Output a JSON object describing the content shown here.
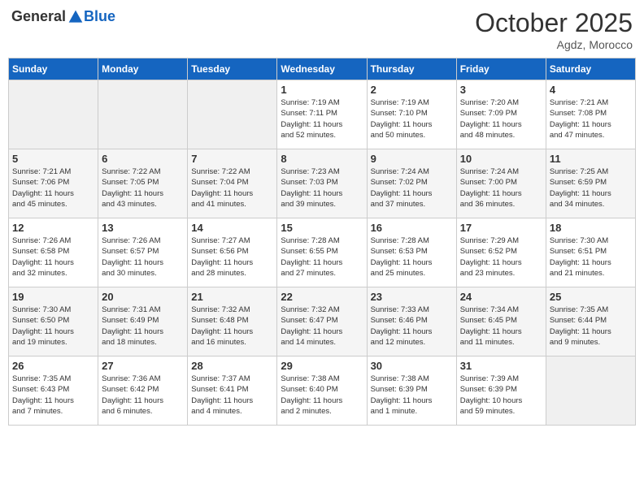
{
  "header": {
    "logo_general": "General",
    "logo_blue": "Blue",
    "month": "October 2025",
    "location": "Agdz, Morocco"
  },
  "weekdays": [
    "Sunday",
    "Monday",
    "Tuesday",
    "Wednesday",
    "Thursday",
    "Friday",
    "Saturday"
  ],
  "weeks": [
    [
      {
        "day": "",
        "info": ""
      },
      {
        "day": "",
        "info": ""
      },
      {
        "day": "",
        "info": ""
      },
      {
        "day": "1",
        "info": "Sunrise: 7:19 AM\nSunset: 7:11 PM\nDaylight: 11 hours\nand 52 minutes."
      },
      {
        "day": "2",
        "info": "Sunrise: 7:19 AM\nSunset: 7:10 PM\nDaylight: 11 hours\nand 50 minutes."
      },
      {
        "day": "3",
        "info": "Sunrise: 7:20 AM\nSunset: 7:09 PM\nDaylight: 11 hours\nand 48 minutes."
      },
      {
        "day": "4",
        "info": "Sunrise: 7:21 AM\nSunset: 7:08 PM\nDaylight: 11 hours\nand 47 minutes."
      }
    ],
    [
      {
        "day": "5",
        "info": "Sunrise: 7:21 AM\nSunset: 7:06 PM\nDaylight: 11 hours\nand 45 minutes."
      },
      {
        "day": "6",
        "info": "Sunrise: 7:22 AM\nSunset: 7:05 PM\nDaylight: 11 hours\nand 43 minutes."
      },
      {
        "day": "7",
        "info": "Sunrise: 7:22 AM\nSunset: 7:04 PM\nDaylight: 11 hours\nand 41 minutes."
      },
      {
        "day": "8",
        "info": "Sunrise: 7:23 AM\nSunset: 7:03 PM\nDaylight: 11 hours\nand 39 minutes."
      },
      {
        "day": "9",
        "info": "Sunrise: 7:24 AM\nSunset: 7:02 PM\nDaylight: 11 hours\nand 37 minutes."
      },
      {
        "day": "10",
        "info": "Sunrise: 7:24 AM\nSunset: 7:00 PM\nDaylight: 11 hours\nand 36 minutes."
      },
      {
        "day": "11",
        "info": "Sunrise: 7:25 AM\nSunset: 6:59 PM\nDaylight: 11 hours\nand 34 minutes."
      }
    ],
    [
      {
        "day": "12",
        "info": "Sunrise: 7:26 AM\nSunset: 6:58 PM\nDaylight: 11 hours\nand 32 minutes."
      },
      {
        "day": "13",
        "info": "Sunrise: 7:26 AM\nSunset: 6:57 PM\nDaylight: 11 hours\nand 30 minutes."
      },
      {
        "day": "14",
        "info": "Sunrise: 7:27 AM\nSunset: 6:56 PM\nDaylight: 11 hours\nand 28 minutes."
      },
      {
        "day": "15",
        "info": "Sunrise: 7:28 AM\nSunset: 6:55 PM\nDaylight: 11 hours\nand 27 minutes."
      },
      {
        "day": "16",
        "info": "Sunrise: 7:28 AM\nSunset: 6:53 PM\nDaylight: 11 hours\nand 25 minutes."
      },
      {
        "day": "17",
        "info": "Sunrise: 7:29 AM\nSunset: 6:52 PM\nDaylight: 11 hours\nand 23 minutes."
      },
      {
        "day": "18",
        "info": "Sunrise: 7:30 AM\nSunset: 6:51 PM\nDaylight: 11 hours\nand 21 minutes."
      }
    ],
    [
      {
        "day": "19",
        "info": "Sunrise: 7:30 AM\nSunset: 6:50 PM\nDaylight: 11 hours\nand 19 minutes."
      },
      {
        "day": "20",
        "info": "Sunrise: 7:31 AM\nSunset: 6:49 PM\nDaylight: 11 hours\nand 18 minutes."
      },
      {
        "day": "21",
        "info": "Sunrise: 7:32 AM\nSunset: 6:48 PM\nDaylight: 11 hours\nand 16 minutes."
      },
      {
        "day": "22",
        "info": "Sunrise: 7:32 AM\nSunset: 6:47 PM\nDaylight: 11 hours\nand 14 minutes."
      },
      {
        "day": "23",
        "info": "Sunrise: 7:33 AM\nSunset: 6:46 PM\nDaylight: 11 hours\nand 12 minutes."
      },
      {
        "day": "24",
        "info": "Sunrise: 7:34 AM\nSunset: 6:45 PM\nDaylight: 11 hours\nand 11 minutes."
      },
      {
        "day": "25",
        "info": "Sunrise: 7:35 AM\nSunset: 6:44 PM\nDaylight: 11 hours\nand 9 minutes."
      }
    ],
    [
      {
        "day": "26",
        "info": "Sunrise: 7:35 AM\nSunset: 6:43 PM\nDaylight: 11 hours\nand 7 minutes."
      },
      {
        "day": "27",
        "info": "Sunrise: 7:36 AM\nSunset: 6:42 PM\nDaylight: 11 hours\nand 6 minutes."
      },
      {
        "day": "28",
        "info": "Sunrise: 7:37 AM\nSunset: 6:41 PM\nDaylight: 11 hours\nand 4 minutes."
      },
      {
        "day": "29",
        "info": "Sunrise: 7:38 AM\nSunset: 6:40 PM\nDaylight: 11 hours\nand 2 minutes."
      },
      {
        "day": "30",
        "info": "Sunrise: 7:38 AM\nSunset: 6:39 PM\nDaylight: 11 hours\nand 1 minute."
      },
      {
        "day": "31",
        "info": "Sunrise: 7:39 AM\nSunset: 6:39 PM\nDaylight: 10 hours\nand 59 minutes."
      },
      {
        "day": "",
        "info": ""
      }
    ]
  ]
}
